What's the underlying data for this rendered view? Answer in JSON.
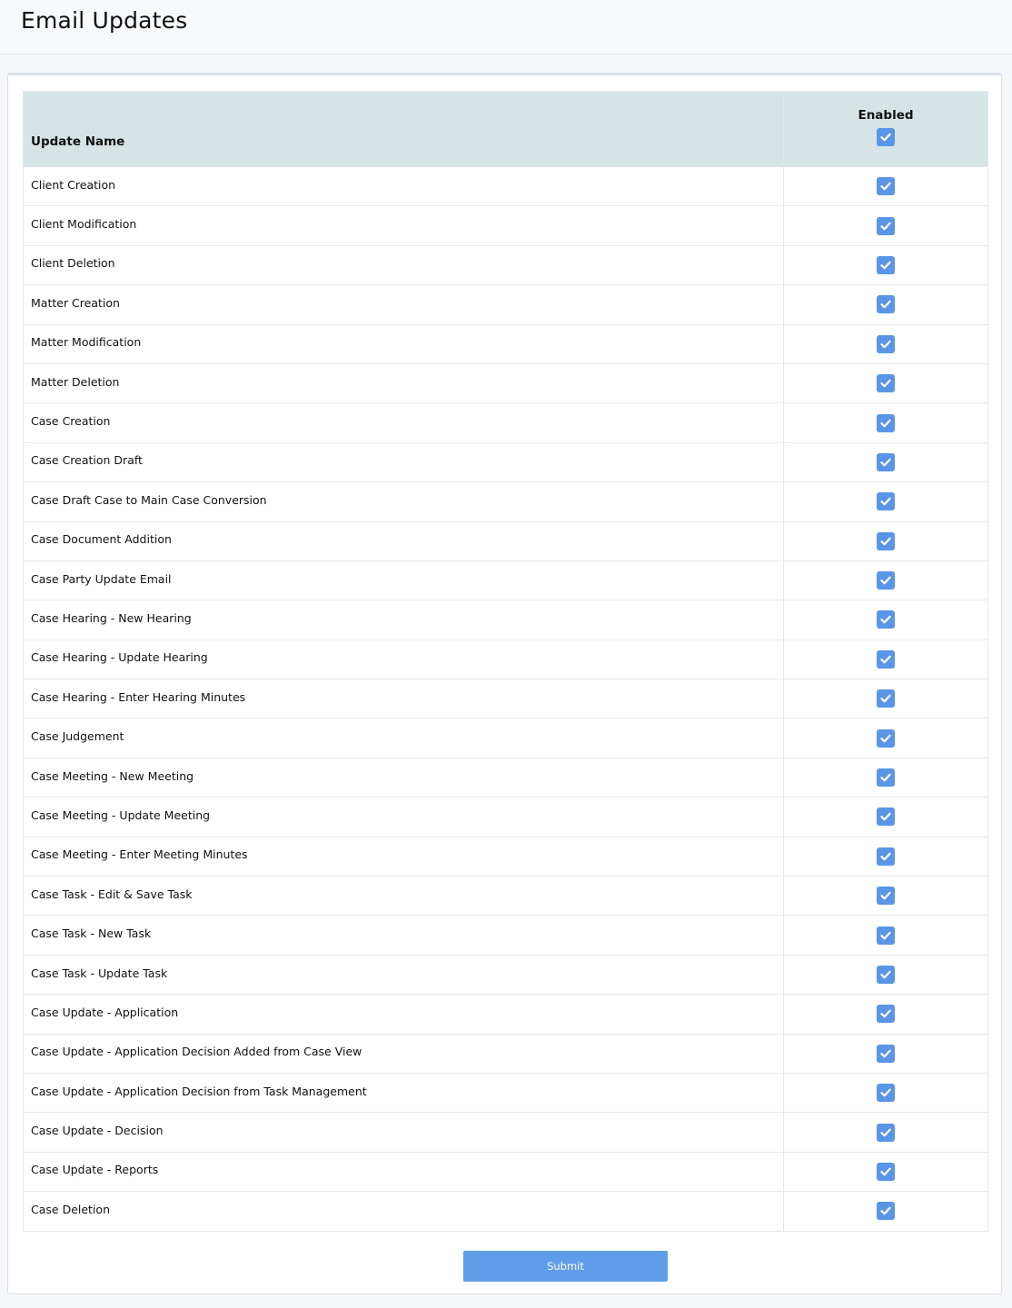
{
  "page": {
    "title": "Email Updates"
  },
  "table": {
    "headers": {
      "name": "Update Name",
      "enabled": "Enabled"
    },
    "header_checked": true,
    "rows": [
      {
        "name": "Client Creation",
        "enabled": true
      },
      {
        "name": "Client Modification",
        "enabled": true
      },
      {
        "name": "Client Deletion",
        "enabled": true
      },
      {
        "name": "Matter Creation",
        "enabled": true
      },
      {
        "name": "Matter Modification",
        "enabled": true
      },
      {
        "name": "Matter Deletion",
        "enabled": true
      },
      {
        "name": "Case Creation",
        "enabled": true
      },
      {
        "name": "Case Creation Draft",
        "enabled": true
      },
      {
        "name": "Case Draft Case to Main Case Conversion",
        "enabled": true
      },
      {
        "name": "Case Document Addition",
        "enabled": true
      },
      {
        "name": "Case Party Update Email",
        "enabled": true
      },
      {
        "name": "Case Hearing - New Hearing",
        "enabled": true
      },
      {
        "name": "Case Hearing - Update Hearing",
        "enabled": true
      },
      {
        "name": "Case Hearing - Enter Hearing Minutes",
        "enabled": true
      },
      {
        "name": "Case Judgement",
        "enabled": true
      },
      {
        "name": "Case Meeting - New Meeting",
        "enabled": true
      },
      {
        "name": "Case Meeting - Update Meeting",
        "enabled": true
      },
      {
        "name": "Case Meeting - Enter Meeting Minutes",
        "enabled": true
      },
      {
        "name": "Case Task - Edit & Save Task",
        "enabled": true
      },
      {
        "name": "Case Task - New Task",
        "enabled": true
      },
      {
        "name": "Case Task - Update Task",
        "enabled": true
      },
      {
        "name": "Case Update - Application",
        "enabled": true
      },
      {
        "name": "Case Update - Application Decision Added from Case View",
        "enabled": true
      },
      {
        "name": "Case Update - Application Decision from Task Management",
        "enabled": true
      },
      {
        "name": "Case Update - Decision",
        "enabled": true
      },
      {
        "name": "Case Update - Reports",
        "enabled": true
      },
      {
        "name": "Case Deletion",
        "enabled": true
      }
    ]
  },
  "actions": {
    "submit_label": "Submit"
  },
  "colors": {
    "checkbox": "#5a95e6",
    "header_bg": "#d6e4e6",
    "submit_bg": "#5f9de9"
  }
}
